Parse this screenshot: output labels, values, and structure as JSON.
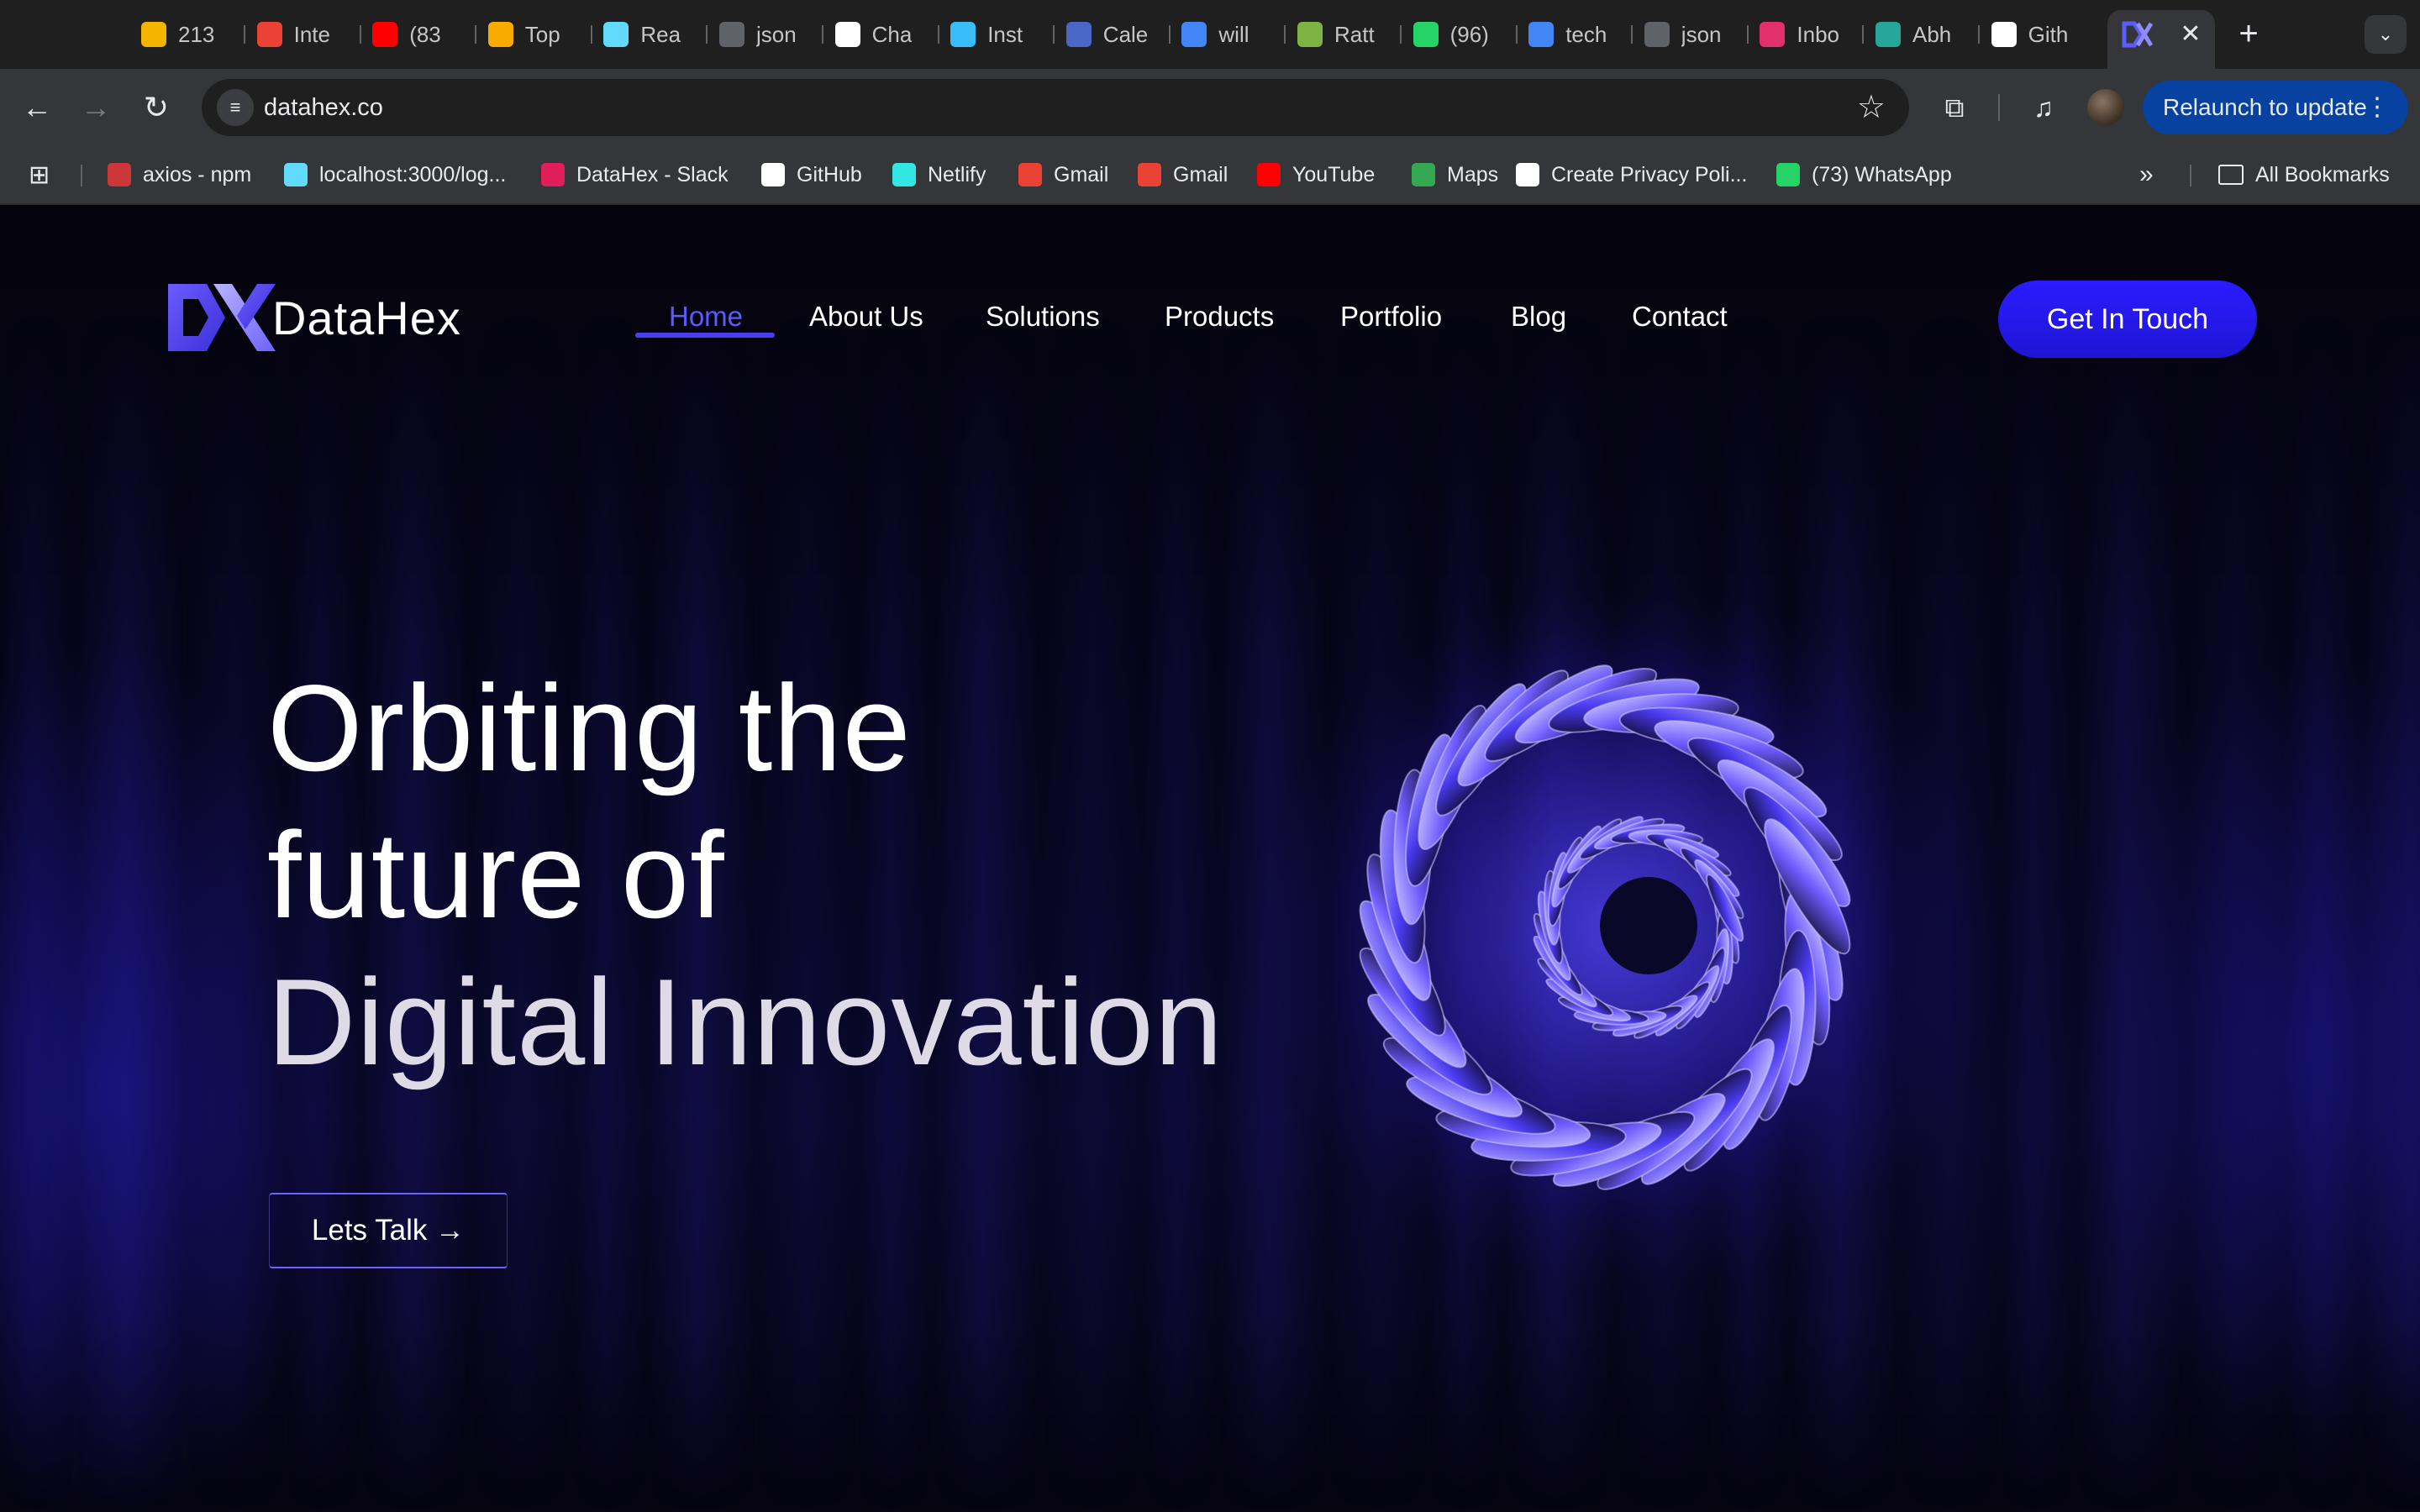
{
  "browser": {
    "tabs": [
      {
        "label": "213",
        "color": "#f4b400"
      },
      {
        "label": "Inte",
        "color": "#ea4335"
      },
      {
        "label": "(83",
        "color": "#ff0000"
      },
      {
        "label": "Top",
        "color": "#f9ab00"
      },
      {
        "label": "Rea",
        "color": "#61dafb"
      },
      {
        "label": "json",
        "color": "#5f6368"
      },
      {
        "label": "Cha",
        "color": "#ffffff"
      },
      {
        "label": "Inst",
        "color": "#38bdf8"
      },
      {
        "label": "Cale",
        "color": "#4a67c7"
      },
      {
        "label": "will",
        "color": "#4285f4"
      },
      {
        "label": "Ratt",
        "color": "#7cb342"
      },
      {
        "label": "(96)",
        "color": "#25d366"
      },
      {
        "label": "tech",
        "color": "#4285f4"
      },
      {
        "label": "json",
        "color": "#5f6368"
      },
      {
        "label": "Inbo",
        "color": "#e1306c"
      },
      {
        "label": "Abh",
        "color": "#26a69a"
      },
      {
        "label": "Gith",
        "color": "#ffffff"
      }
    ],
    "active_tab_icon": "datahex-logo-icon",
    "url": "datahex.co",
    "relaunch_label": "Relaunch to update",
    "bookmarks": [
      {
        "label": "axios - npm",
        "color": "#cb3837"
      },
      {
        "label": "localhost:3000/log...",
        "color": "#61dafb"
      },
      {
        "label": "DataHex - Slack",
        "color": "#e01e5a"
      },
      {
        "label": "GitHub",
        "color": "#ffffff"
      },
      {
        "label": "Netlify",
        "color": "#32e6e2"
      },
      {
        "label": "Gmail",
        "color": "#ea4335"
      },
      {
        "label": "Gmail",
        "color": "#ea4335"
      },
      {
        "label": "YouTube",
        "color": "#ff0000"
      },
      {
        "label": "Maps",
        "color": "#34a853"
      },
      {
        "label": "Create Privacy Poli...",
        "color": "#ffffff"
      },
      {
        "label": "(73) WhatsApp",
        "color": "#25d366"
      }
    ],
    "all_bookmarks_label": "All Bookmarks"
  },
  "site": {
    "brand": "DataHex",
    "nav": [
      "Home",
      "About Us",
      "Solutions",
      "Products",
      "Portfolio",
      "Blog",
      "Contact"
    ],
    "active_nav": "Home",
    "cta_label": "Get In Touch",
    "hero": {
      "line1": "Orbiting the",
      "line2": "future of",
      "line3": "Digital Innovation"
    },
    "talk_label": "Lets Talk →",
    "accent_color": "#2a1cff"
  }
}
